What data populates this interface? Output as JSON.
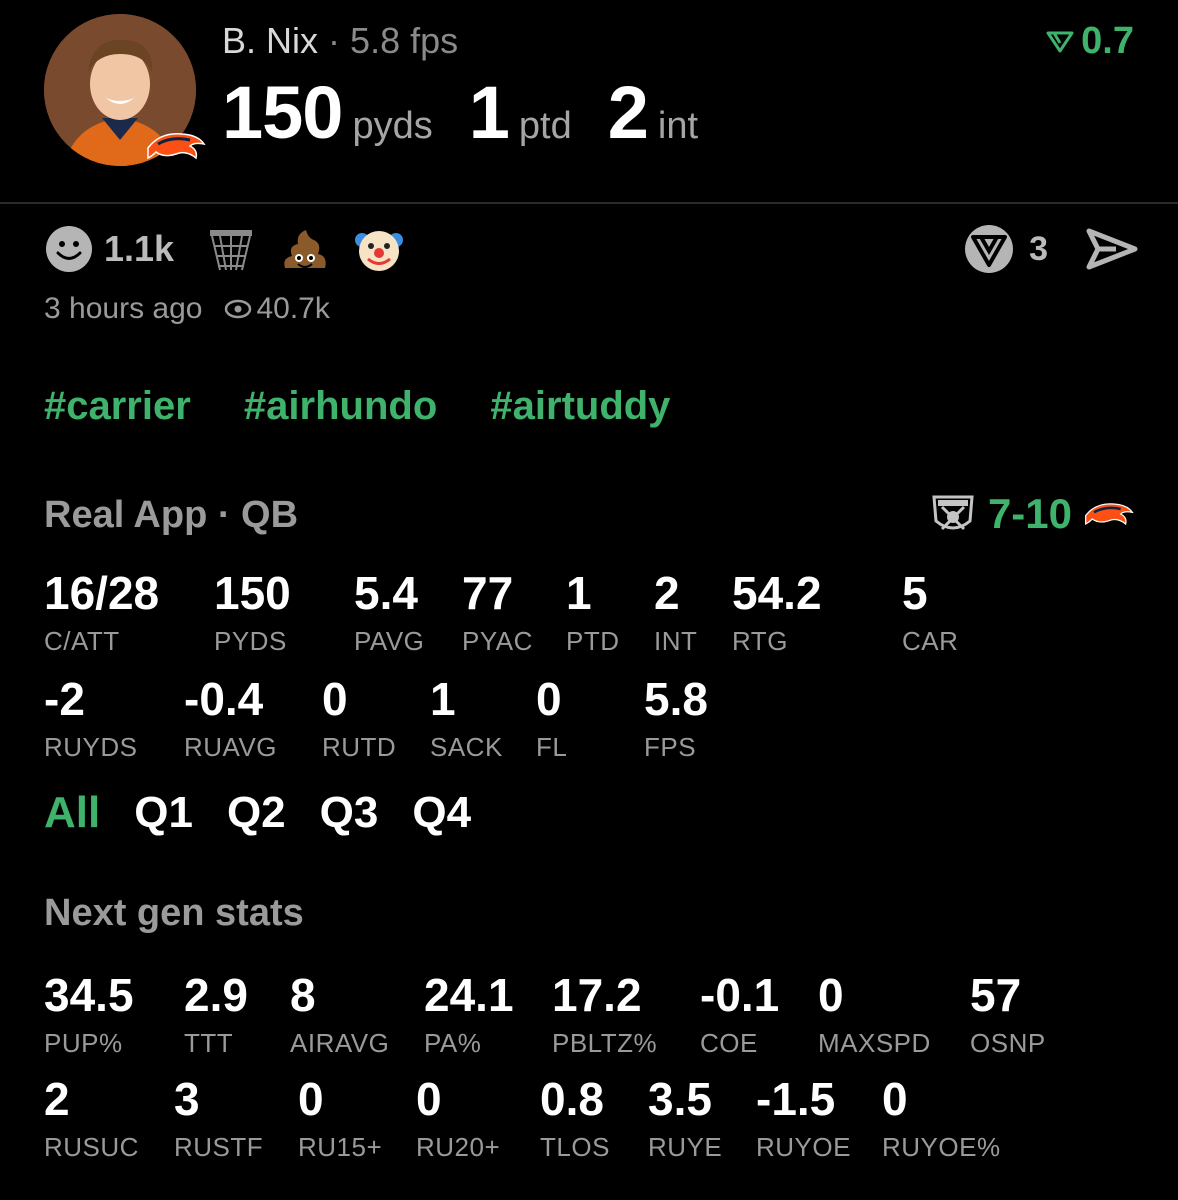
{
  "player": {
    "name": "B. Nix",
    "separator": "·",
    "fps": "5.8 fps",
    "avatar_bg": "#7a4a2e"
  },
  "headline": [
    {
      "value": "150",
      "unit": "pyds"
    },
    {
      "value": "1",
      "unit": "ptd"
    },
    {
      "value": "2",
      "unit": "int"
    }
  ],
  "rank_delta": "0.7",
  "reactions": {
    "smile_count": "1.1k",
    "icons": [
      "smile-icon",
      "basketball-hoop-icon",
      "poop-emoji-icon",
      "clown-emoji-icon"
    ]
  },
  "share_count": "3",
  "meta": {
    "time_ago": "3 hours ago",
    "views": "40.7k"
  },
  "hashtags": [
    "#carrier",
    "#airhundo",
    "#airtuddy"
  ],
  "box_section": {
    "title": "Real App · QB",
    "score": "7-10"
  },
  "box_stats_row1": [
    {
      "v": "16/28",
      "l": "C/ATT"
    },
    {
      "v": "150",
      "l": "PYDS"
    },
    {
      "v": "5.4",
      "l": "PAVG"
    },
    {
      "v": "77",
      "l": "PYAC"
    },
    {
      "v": "1",
      "l": "PTD"
    },
    {
      "v": "2",
      "l": "INT"
    },
    {
      "v": "54.2",
      "l": "RTG"
    },
    {
      "v": "5",
      "l": "CAR"
    }
  ],
  "box_stats_row2": [
    {
      "v": "-2",
      "l": "RUYDS"
    },
    {
      "v": "-0.4",
      "l": "RUAVG"
    },
    {
      "v": "0",
      "l": "RUTD"
    },
    {
      "v": "1",
      "l": "SACK"
    },
    {
      "v": "0",
      "l": "FL"
    },
    {
      "v": "5.8",
      "l": "FPS"
    }
  ],
  "quarter_tabs": [
    "All",
    "Q1",
    "Q2",
    "Q3",
    "Q4"
  ],
  "next_gen": {
    "title": "Next gen stats"
  },
  "ng_row1": [
    {
      "v": "34.5",
      "l": "PUP%"
    },
    {
      "v": "2.9",
      "l": "TTT"
    },
    {
      "v": "8",
      "l": "AIRAVG"
    },
    {
      "v": "24.1",
      "l": "PA%"
    },
    {
      "v": "17.2",
      "l": "PBLTZ%"
    },
    {
      "v": "-0.1",
      "l": "COE"
    },
    {
      "v": "0",
      "l": "MAXSPD"
    },
    {
      "v": "57",
      "l": "OSNP"
    }
  ],
  "ng_row2": [
    {
      "v": "2",
      "l": "RUSUC"
    },
    {
      "v": "3",
      "l": "RUSTF"
    },
    {
      "v": "0",
      "l": "RU15+"
    },
    {
      "v": "0",
      "l": "RU20+"
    },
    {
      "v": "0.8",
      "l": "TLOS"
    },
    {
      "v": "3.5",
      "l": "RUYE"
    },
    {
      "v": "-1.5",
      "l": "RUYOE"
    },
    {
      "v": "0",
      "l": "RUYOE%"
    }
  ],
  "colors": {
    "accent": "#3fb26b",
    "muted": "#9a9a9a",
    "background": "#000000"
  }
}
